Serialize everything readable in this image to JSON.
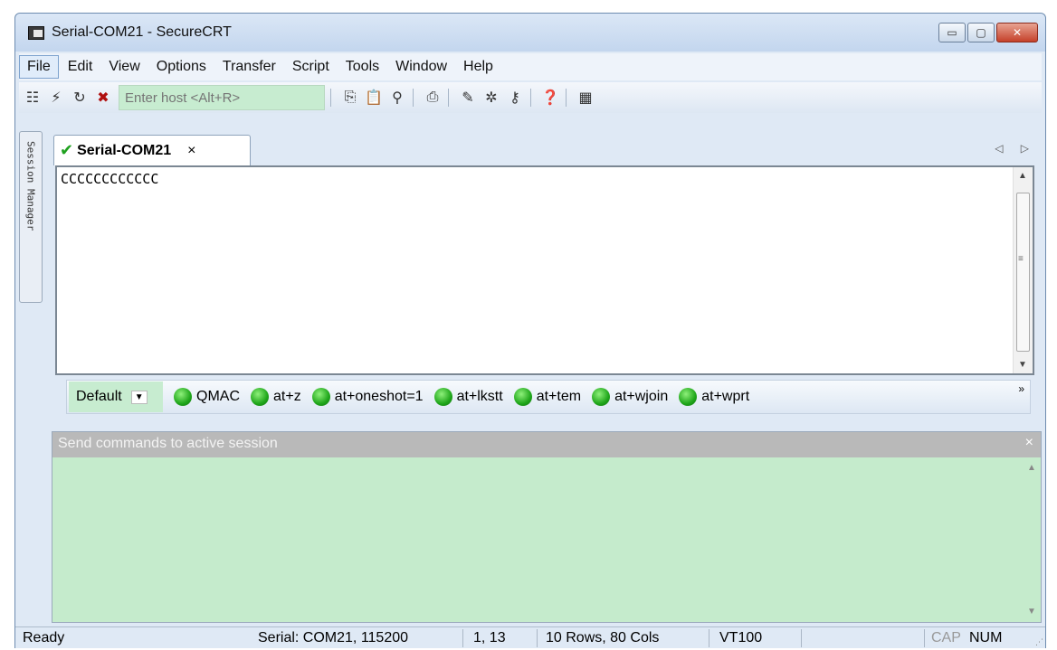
{
  "window": {
    "title": "Serial-COM21 - SecureCRT",
    "controls": {
      "minimize": "▭",
      "maximize": "▢",
      "close": "✕"
    }
  },
  "menu": {
    "items": [
      {
        "label": "File"
      },
      {
        "label": "Edit"
      },
      {
        "label": "View"
      },
      {
        "label": "Options"
      },
      {
        "label": "Transfer"
      },
      {
        "label": "Script"
      },
      {
        "label": "Tools"
      },
      {
        "label": "Window"
      },
      {
        "label": "Help"
      }
    ]
  },
  "toolbar": {
    "host_placeholder": "Enter host <Alt+R>",
    "icons": [
      "connect-icon",
      "quick-connect-icon",
      "reconnect-icon",
      "disconnect-icon",
      "copy-icon",
      "paste-icon",
      "find-icon",
      "print-icon",
      "session-options-icon",
      "sftp-icon",
      "keymap-icon",
      "help-icon",
      "script-icon"
    ]
  },
  "sidebar": {
    "label": "Session Manager"
  },
  "tabs": {
    "active": {
      "label": "Serial-COM21",
      "close": "×"
    },
    "nav": "◁ ▷"
  },
  "terminal": {
    "text": "CCCCCCCCCCCC"
  },
  "buttonbar": {
    "selector": "Default",
    "buttons": [
      {
        "label": "QMAC"
      },
      {
        "label": "at+z"
      },
      {
        "label": "at+oneshot=1"
      },
      {
        "label": "at+lkstt"
      },
      {
        "label": "at+tem"
      },
      {
        "label": "at+wjoin"
      },
      {
        "label": "at+wprt"
      }
    ],
    "overflow": "»"
  },
  "send": {
    "header": "Send commands to active session",
    "close": "×"
  },
  "status": {
    "ready": "Ready",
    "connection": "Serial: COM21, 115200",
    "cursor": "1,  13",
    "size": "10 Rows, 80 Cols",
    "emulation": "VT100",
    "cap": "CAP",
    "num": "NUM"
  },
  "colors": {
    "accent_green": "#c7ecd0",
    "led_green": "#1fa61a",
    "send_header_gray": "#b9b9b9"
  }
}
